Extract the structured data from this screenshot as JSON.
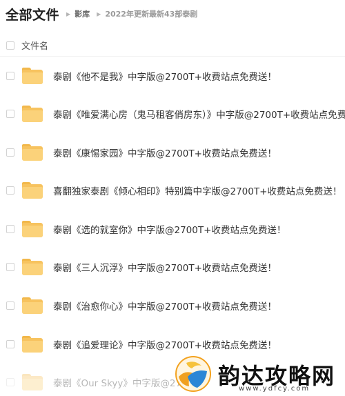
{
  "header": {
    "title": "全部文件",
    "breadcrumb": [
      "影库",
      "2022年更新最新43部泰剧"
    ]
  },
  "list": {
    "column_label": "文件名",
    "files": [
      {
        "name": "泰剧《他不是我》中字版@2700T+收费站点免费送！"
      },
      {
        "name": "泰剧《唯爱满心房（鬼马租客俏房东）》中字版@2700T+收费站点免费"
      },
      {
        "name": "泰剧《康惕家园》中字版@2700T+收费站点免费送！"
      },
      {
        "name": "喜翻独家泰剧《倾心相印》特别篇中字版@2700T+收费站点免费送！"
      },
      {
        "name": "泰剧《选的就室你》中字版@2700T+收费站点免费送！"
      },
      {
        "name": "泰剧《三人沉浮》中字版@2700T+收费站点免费送！"
      },
      {
        "name": "泰剧《治愈你心》中字版@2700T+收费站点免费送！"
      },
      {
        "name": "泰剧《追爱理论》中字版@2700T+收费站点免费送！"
      },
      {
        "name": "泰剧《Our Skyy》中字版@27"
      }
    ]
  },
  "watermark": {
    "text": "韵达攻略网",
    "url": "www.ydfcy.com"
  },
  "colors": {
    "folder": "#f7c35f",
    "text": "#333333",
    "divider": "#f0f0f0"
  }
}
